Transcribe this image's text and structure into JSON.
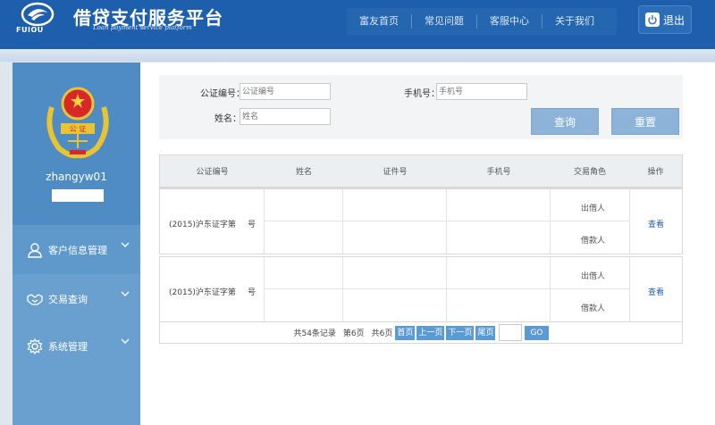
{
  "header": {
    "logo_text": "FUIOU",
    "title": "借贷支付服务平台",
    "subtitle": "Loan payment service platform",
    "nav": [
      "富友首页",
      "常见问题",
      "客服中心",
      "关于我们"
    ],
    "logout_label": "退出"
  },
  "sidebar": {
    "username": "zhangyw01",
    "menu": [
      {
        "label": "客户信息管理",
        "icon": "user-icon"
      },
      {
        "label": "交易查询",
        "icon": "handshake-icon"
      },
      {
        "label": "系统管理",
        "icon": "gear-icon"
      }
    ]
  },
  "search": {
    "notary_label": "公证编号：",
    "notary_placeholder": "公证编号",
    "phone_label": "手机号：",
    "phone_placeholder": "手机号",
    "name_label": "姓名：",
    "name_placeholder": "姓名",
    "query_button": "查询",
    "reset_button": "重置"
  },
  "table": {
    "headers": [
      "公证编号",
      "姓名",
      "证件号",
      "手机号",
      "交易角色",
      "操作"
    ],
    "rows": [
      {
        "notary_no": "(2015)沪东证字第",
        "suffix": "号",
        "roles": [
          "出借人",
          "借款人"
        ],
        "action": "查看"
      },
      {
        "notary_no": "(2015)沪东证字第",
        "suffix": "号",
        "roles": [
          "出借人",
          "借款人"
        ],
        "action": "查看"
      }
    ]
  },
  "pager": {
    "total": "共54条记录",
    "current": "第6页",
    "pages": "共6页",
    "first": "首页",
    "prev": "上一页",
    "next": "下一页",
    "last": "尾页",
    "go": "GO"
  },
  "colors": {
    "header": "#1e5fad",
    "sidebar": "#6aa0cf",
    "button": "#8db4d8",
    "pager_button": "#5b9bd5"
  }
}
